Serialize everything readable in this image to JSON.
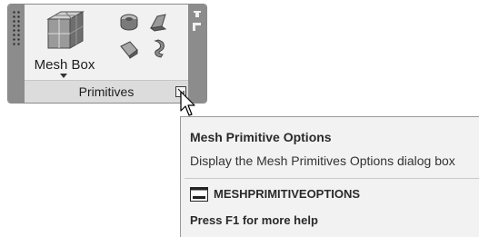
{
  "panel": {
    "title": "Primitives",
    "mesh_box_label": "Mesh Box"
  },
  "icons": {
    "grip": "grip-dots-icon",
    "pin": "pin-icon",
    "float": "float-panel-icon",
    "mesh_box": "mesh-box-icon",
    "cylinder": "mesh-cylinder-icon",
    "wedge": "mesh-wedge-icon",
    "cone": "mesh-cone-icon",
    "torus": "mesh-torus-icon",
    "launcher": "dialog-launcher-icon",
    "cursor": "cursor-arrow-icon",
    "command": "command-icon"
  },
  "tooltip": {
    "title": "Mesh Primitive Options",
    "description": "Display the Mesh Primitives Options dialog box",
    "command": "MESHPRIMITIVEOPTIONS",
    "help": "Press F1 for more help"
  },
  "colors": {
    "panel_bg": "#f1f1f1",
    "panel_strip": "#8c8c8c",
    "footer_bg": "#dcdcdc",
    "tooltip_bg": "#f2f2f2"
  }
}
